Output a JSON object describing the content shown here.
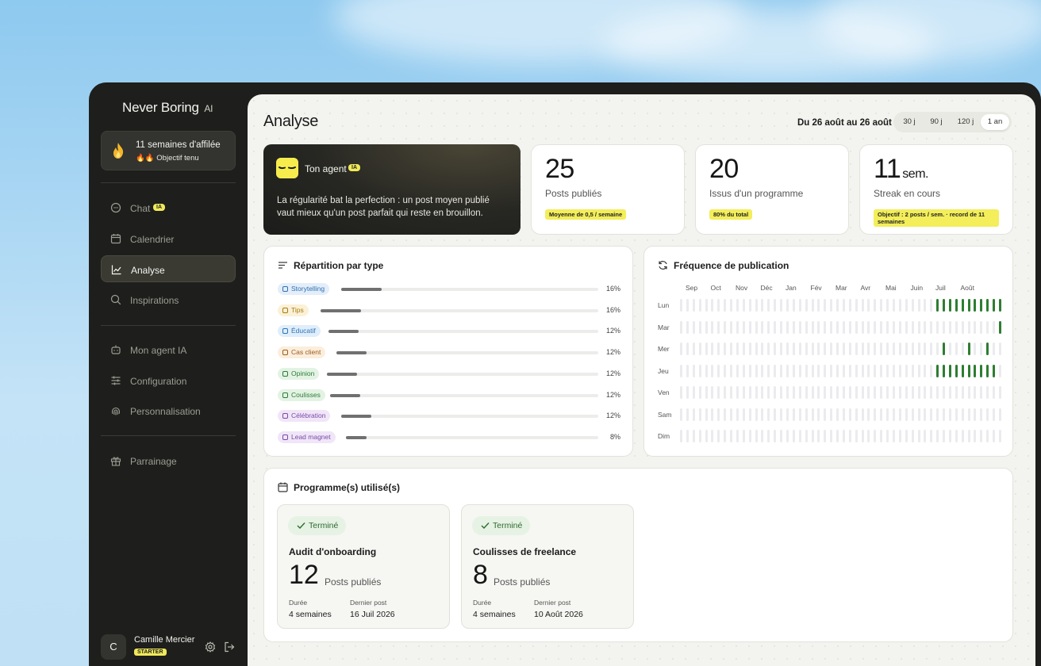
{
  "app": {
    "brand": "Never Boring",
    "brand_suffix": "AI"
  },
  "sidebar": {
    "streak": {
      "title": "11 semaines d'affilée",
      "subtitle": "🔥🔥 Objectif tenu"
    },
    "items": [
      {
        "label": "Chat",
        "icon": "chat-icon",
        "badge": "IA",
        "active": false
      },
      {
        "label": "Calendrier",
        "icon": "calendar-icon",
        "active": false
      },
      {
        "label": "Analyse",
        "icon": "chart-line-icon",
        "active": true
      },
      {
        "label": "Inspirations",
        "icon": "search-icon",
        "active": false
      },
      {
        "label": "Mon agent IA",
        "icon": "robot-icon",
        "active": false
      },
      {
        "label": "Configuration",
        "icon": "sliders-icon",
        "active": false
      },
      {
        "label": "Personnalisation",
        "icon": "fingerprint-icon",
        "active": false
      },
      {
        "label": "Parrainage",
        "icon": "gift-icon",
        "active": false
      }
    ],
    "user": {
      "initial": "C",
      "name": "Camille Mercier",
      "plan": "STARTER"
    }
  },
  "header": {
    "title": "Analyse",
    "date_range": "Du 26 août au 26 août",
    "ranges": [
      {
        "label": "30 j",
        "active": false
      },
      {
        "label": "90 j",
        "active": false
      },
      {
        "label": "120 j",
        "active": false
      },
      {
        "label": "1 an",
        "active": true
      }
    ]
  },
  "agent_card": {
    "title": "Ton agent",
    "badge": "IA",
    "quote": "La régularité bat la perfection : un post moyen publié vaut mieux qu'un post parfait qui reste en brouillon."
  },
  "stats": [
    {
      "value": "25",
      "unit": "",
      "label": "Posts publiés",
      "pill": "Moyenne de 0,5 / semaine"
    },
    {
      "value": "20",
      "unit": "",
      "label": "Issus d'un programme",
      "pill": "80% du total"
    },
    {
      "value": "11",
      "unit": "sem.",
      "label": "Streak en cours",
      "pill": "Objectif : 2 posts / sem. · record de 11 semaines"
    }
  ],
  "types": {
    "title": "Répartition par type",
    "rows": [
      {
        "label": "Storytelling",
        "percent": "16%",
        "value": 0.16,
        "color": "#2f6fb0",
        "bg": "#e3eefa"
      },
      {
        "label": "Tips",
        "percent": "16%",
        "value": 0.16,
        "color": "#a87a10",
        "bg": "#fbf1d6"
      },
      {
        "label": "Éducatif",
        "percent": "12%",
        "value": 0.12,
        "color": "#2b73b8",
        "bg": "#e0eefb"
      },
      {
        "label": "Cas client",
        "percent": "12%",
        "value": 0.12,
        "color": "#a05a1a",
        "bg": "#fbeedd"
      },
      {
        "label": "Opinion",
        "percent": "12%",
        "value": 0.12,
        "color": "#2e7a3a",
        "bg": "#e3f3e3"
      },
      {
        "label": "Coulisses",
        "percent": "12%",
        "value": 0.12,
        "color": "#2e7a3a",
        "bg": "#e3f3e3"
      },
      {
        "label": "Célébration",
        "percent": "12%",
        "value": 0.12,
        "color": "#7a4aa8",
        "bg": "#f0e6f8"
      },
      {
        "label": "Lead magnet",
        "percent": "8%",
        "value": 0.08,
        "color": "#7a4aa8",
        "bg": "#f0e6f8"
      }
    ]
  },
  "frequency": {
    "title": "Fréquence de publication",
    "months": [
      "Sep",
      "Oct",
      "Nov",
      "Déc",
      "Jan",
      "Fév",
      "Mar",
      "Avr",
      "Mai",
      "Juin",
      "Juil",
      "Août"
    ],
    "days": [
      "Lun",
      "Mar",
      "Mer",
      "Jeu",
      "Ven",
      "Sam",
      "Dim"
    ],
    "weeks": 52,
    "posts": {
      "Lun": [
        41,
        42,
        43,
        44,
        45,
        46,
        47,
        48,
        49,
        50,
        51
      ],
      "Mar": [
        51
      ],
      "Mer": [
        42,
        46,
        49
      ],
      "Jeu": [
        41,
        42,
        43,
        44,
        45,
        46,
        47,
        48,
        49,
        50
      ]
    }
  },
  "programs": {
    "title": "Programme(s) utilisé(s)",
    "items": [
      {
        "status": "Terminé",
        "name": "Audit d'onboarding",
        "posts": "12",
        "posts_label": "Posts publiés",
        "duration_label": "Durée",
        "duration": "4 semaines",
        "last_label": "Dernier post",
        "last": "16 Juil 2026"
      },
      {
        "status": "Terminé",
        "name": "Coulisses de freelance",
        "posts": "8",
        "posts_label": "Posts publiés",
        "duration_label": "Durée",
        "duration": "4 semaines",
        "last_label": "Dernier post",
        "last": "10 Août 2026"
      }
    ]
  }
}
